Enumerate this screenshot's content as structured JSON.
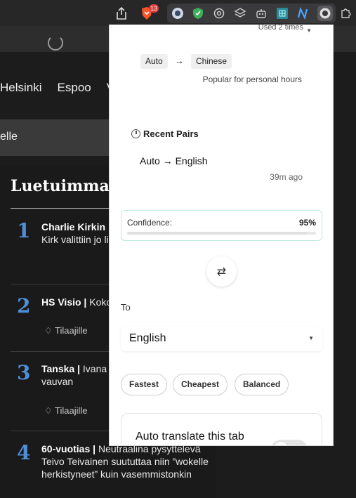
{
  "toolbar": {
    "icons": [
      "share-icon",
      "brave-shields-icon",
      "extension-1-icon",
      "extension-2-icon",
      "chatgpt-icon",
      "layers-icon",
      "robot-icon",
      "grid-icon",
      "n-icon",
      "translator-icon",
      "puzzle-icon"
    ],
    "shields_count": "13"
  },
  "page": {
    "nav": [
      "Helsinki",
      "Espoo",
      "V"
    ],
    "bar_text": "elle",
    "section_title": "Luetuimmat",
    "articles": [
      {
        "num": "1",
        "bold": "Charlie Kirkin",
        "rest": "Kirk valittiin jo liikettä, jossa n kotona",
        "sub": ""
      },
      {
        "num": "2",
        "bold": "HS Visio |",
        "rest": "Koko on saamassa p",
        "sub": "Tilaajille"
      },
      {
        "num": "3",
        "bold": "Tanska |",
        "rest": "Ivana tunnin ikäinen veivät vauvan",
        "sub": "Tilaajille"
      },
      {
        "num": "4",
        "bold": "60-vuotias |",
        "rest": "Neutraalina pysyttelevä Teivo Teivainen suututtaa niin ”wokelle herkistyneet” kuin vasemmistonkin",
        "sub": ""
      }
    ]
  },
  "popup": {
    "used": "Used 2 times",
    "from_chip": "Auto",
    "to_chip": "Chinese",
    "popular": "Popular for personal hours",
    "recent_title": "Recent Pairs",
    "recent_pair": "Auto → English",
    "recent_ago": "39m ago",
    "confidence_label": "Confidence:",
    "confidence_value": "95%",
    "confidence_fraction": 0.95,
    "to_label": "To",
    "to_value": "English",
    "modes": [
      "Fastest",
      "Cheapest",
      "Balanced"
    ],
    "auto_translate": "Auto translate this tab",
    "auto_translate_on": false
  }
}
